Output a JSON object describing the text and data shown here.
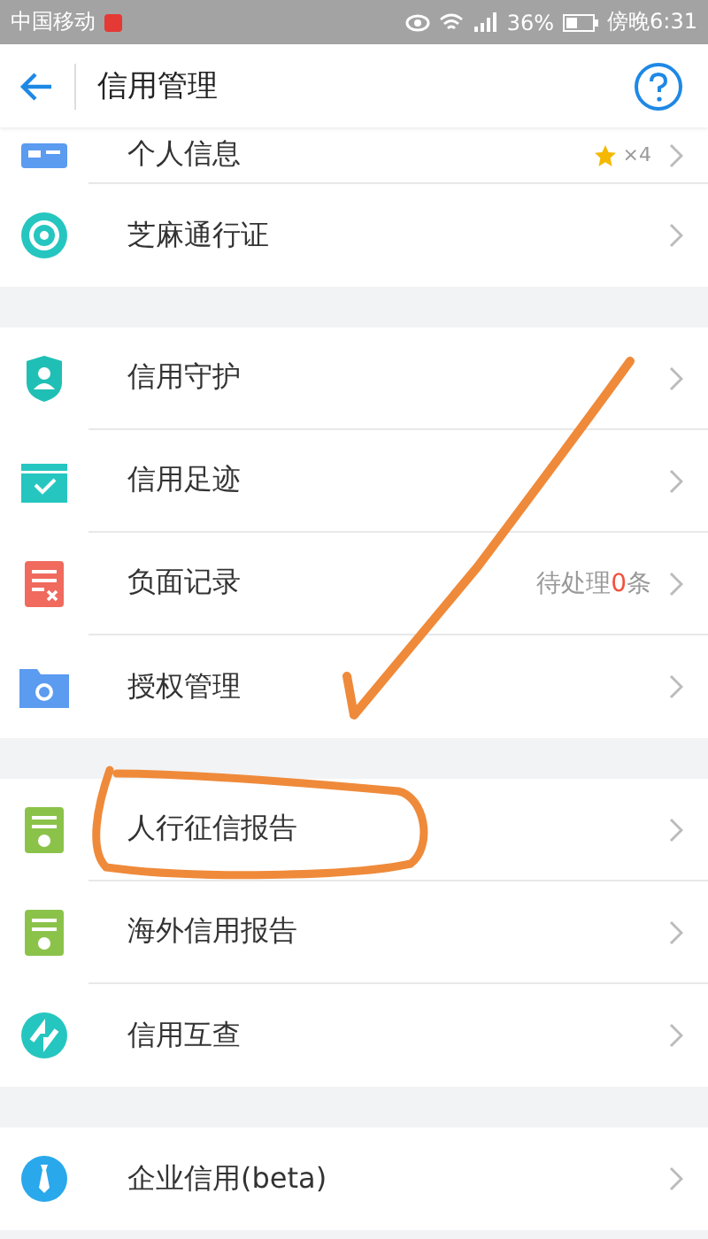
{
  "status_bar": {
    "carrier": "中国移动",
    "battery": "36%",
    "time": "傍晚6:31"
  },
  "header": {
    "title": "信用管理"
  },
  "sections": [
    {
      "items": [
        {
          "label": "个人信息",
          "badge": "×4",
          "partial": true
        },
        {
          "label": "芝麻通行证"
        }
      ]
    },
    {
      "items": [
        {
          "label": "信用守护"
        },
        {
          "label": "信用足迹"
        },
        {
          "label": "负面记录",
          "note": {
            "before": "待处理",
            "count": "0",
            "after": "条"
          }
        },
        {
          "label": "授权管理"
        }
      ]
    },
    {
      "items": [
        {
          "label": "人行征信报告"
        },
        {
          "label": "海外信用报告"
        },
        {
          "label": "信用互查"
        }
      ]
    },
    {
      "items": [
        {
          "label": "企业信用(beta)"
        }
      ]
    }
  ]
}
